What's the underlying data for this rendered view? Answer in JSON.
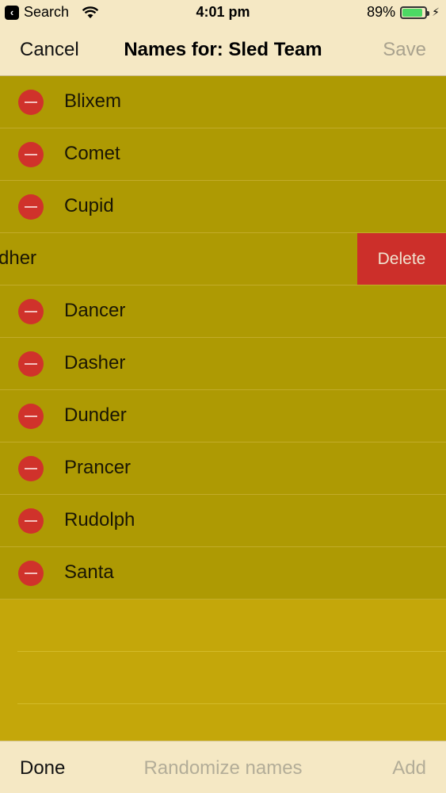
{
  "status_bar": {
    "back_label": "Search",
    "time": "4:01 pm",
    "battery": "89%",
    "battery_level": 0.89
  },
  "nav": {
    "cancel_label": "Cancel",
    "title": "Names for: Sled Team",
    "save_label": "Save"
  },
  "rows": [
    {
      "label": "Blixem"
    },
    {
      "label": "Comet"
    },
    {
      "label": "Cupid"
    },
    {
      "label": "dher",
      "delete_label": "Delete"
    },
    {
      "label": "Dancer"
    },
    {
      "label": "Dasher"
    },
    {
      "label": "Dunder"
    },
    {
      "label": "Prancer"
    },
    {
      "label": "Rudolph"
    },
    {
      "label": "Santa"
    }
  ],
  "toolbar": {
    "done_label": "Done",
    "randomize_label": "Randomize names",
    "add_label": "Add"
  },
  "colors": {
    "background": "#c4a70a",
    "row": "#ae9a03",
    "bars": "#f5e8c4",
    "delete_red": "#cc2f2a"
  }
}
